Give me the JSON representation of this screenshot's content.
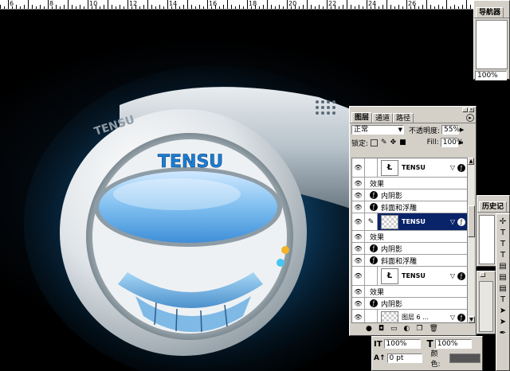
{
  "ruler": {
    "labels": [
      "6",
      "8",
      "10",
      "12",
      "14",
      "16",
      "18",
      "20",
      "22",
      "24",
      "26"
    ]
  },
  "artwork": {
    "brand": "TENSU",
    "embossed": "TENSU"
  },
  "navigator": {
    "tab": "导航器",
    "zoom": "100%"
  },
  "layers_panel": {
    "tabs": [
      "图层",
      "通道",
      "路径"
    ],
    "blend_mode": "正常",
    "opacity_label": "不透明度:",
    "opacity_value": "55%",
    "lock_label": "锁定:",
    "fill_label": "Fill:",
    "fill_value": "100%",
    "layers": [
      {
        "name": "TENSU",
        "type": "text"
      },
      {
        "effects_label": "效果"
      },
      {
        "effect": "内阴影"
      },
      {
        "effect": "斜面和浮雕"
      },
      {
        "name": "TENSU",
        "type": "pixel",
        "selected": true
      },
      {
        "effects_label": "效果"
      },
      {
        "effect": "内阴影"
      },
      {
        "effect": "斜面和浮雕"
      },
      {
        "name": "TENSU",
        "type": "text"
      },
      {
        "effects_label": "效果"
      },
      {
        "effect": "内阴影"
      },
      {
        "name": "图层 6 ...",
        "type": "pixel"
      }
    ]
  },
  "history": {
    "tab": "历史记"
  },
  "character": {
    "vscale": "100%",
    "hscale": "100%",
    "baseline": "0 pt",
    "color_label": "颜色:"
  },
  "colors": {
    "accent": "#0a246a",
    "panel": "#d4d0c8",
    "brand_blue": "#1a7fd4"
  }
}
